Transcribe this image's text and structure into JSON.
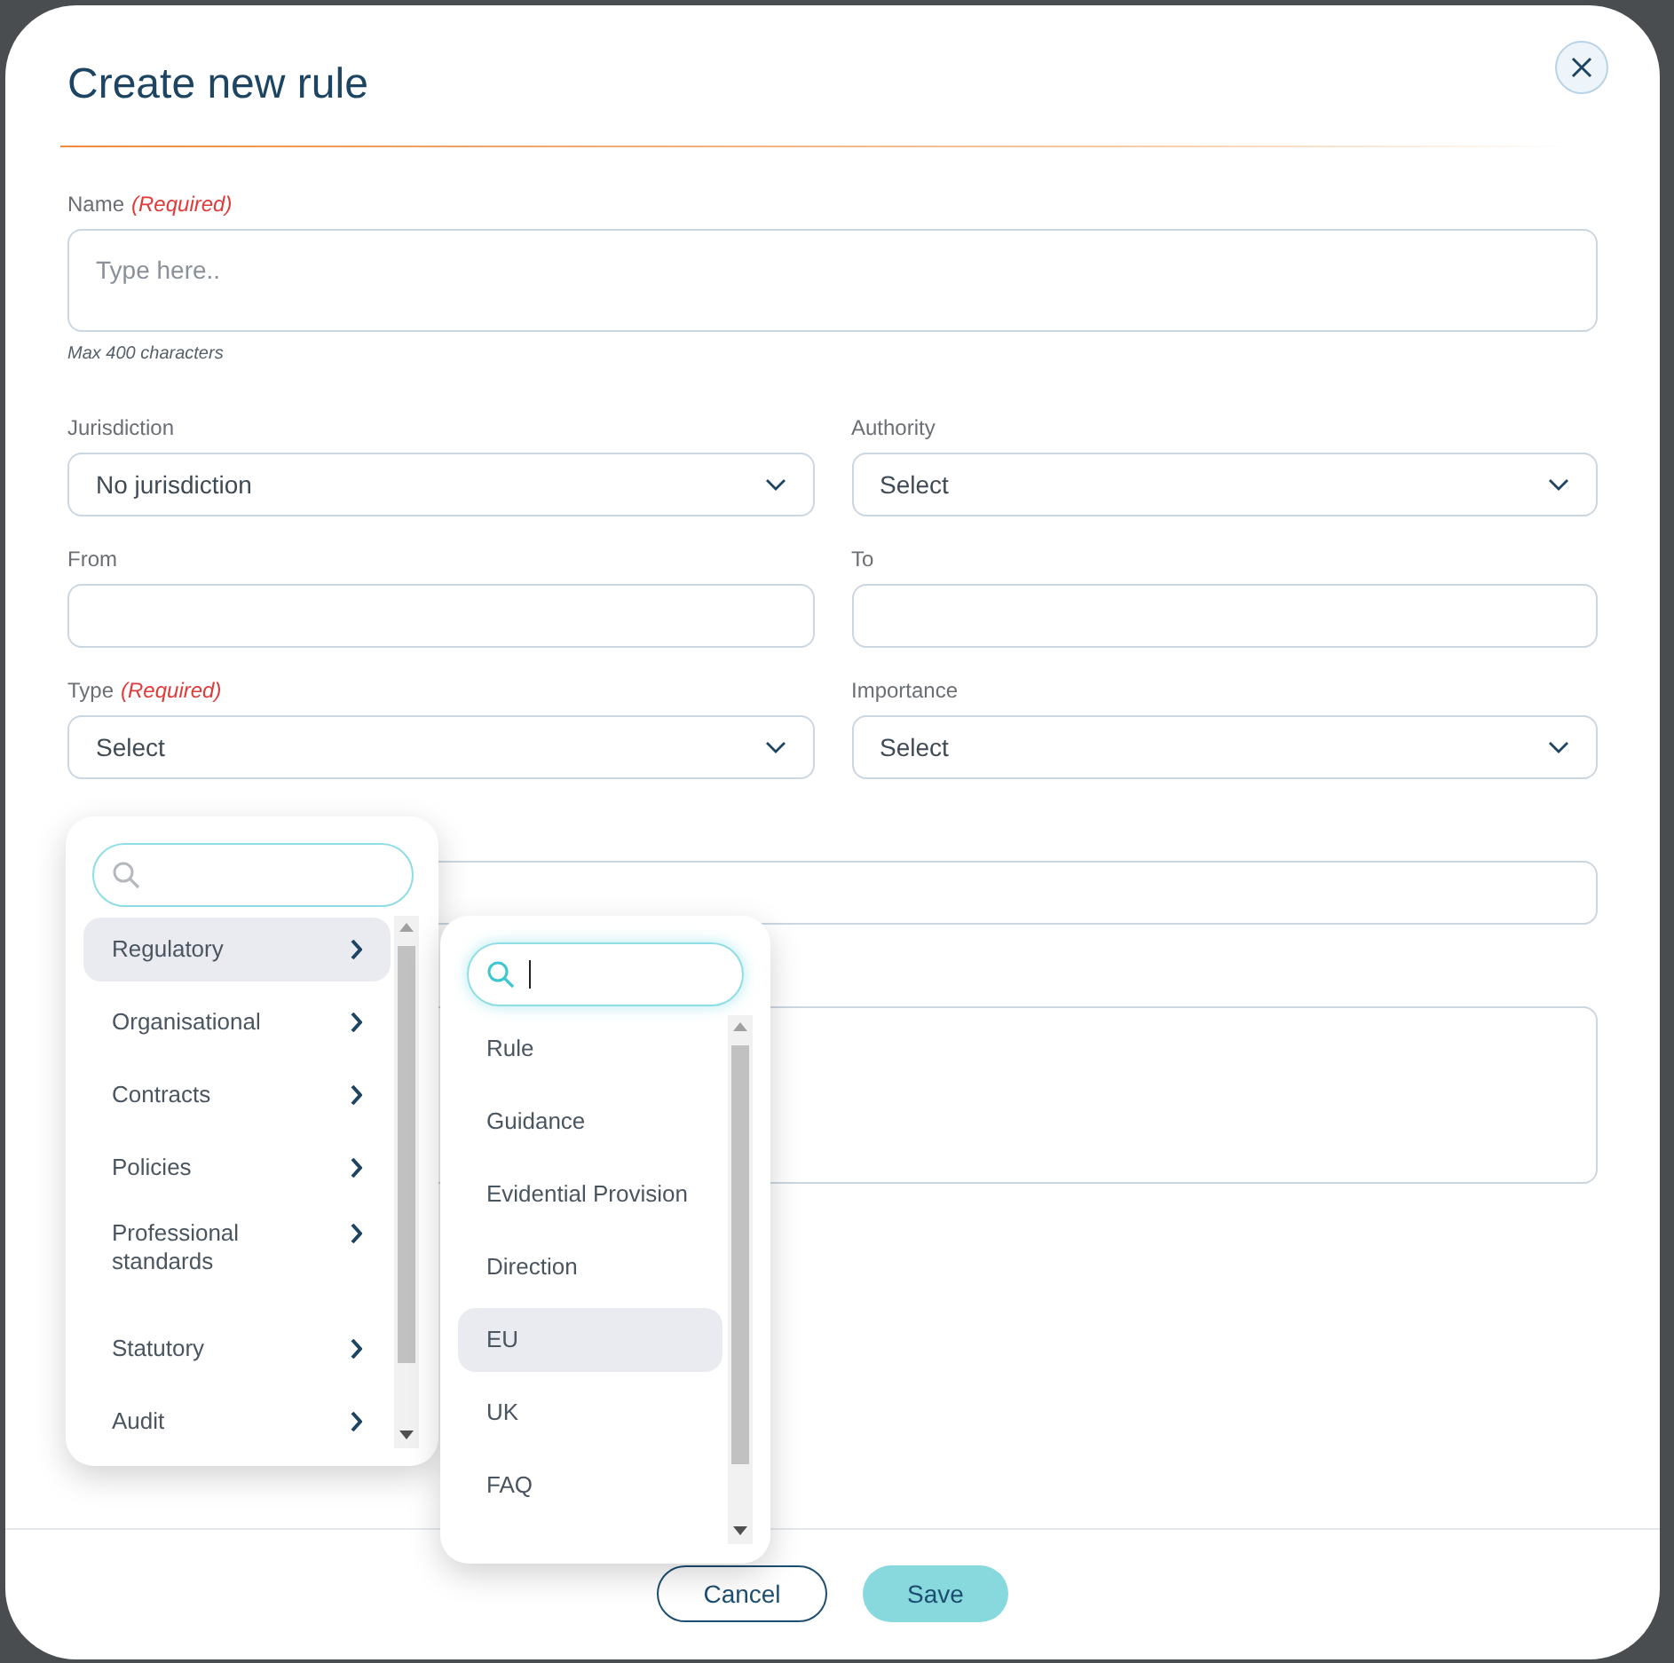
{
  "dialog": {
    "title": "Create new rule"
  },
  "name_field": {
    "label": "Name",
    "required": "(Required)",
    "placeholder": "Type here..",
    "hint": "Max 400 characters"
  },
  "fields": [
    {
      "kind": "select",
      "label": "Jurisdiction",
      "value": "No jurisdiction"
    },
    {
      "kind": "select",
      "label": "Authority",
      "value": "Select"
    },
    {
      "kind": "text",
      "label": "From"
    },
    {
      "kind": "text",
      "label": "To"
    },
    {
      "kind": "select",
      "label": "Type",
      "required": "(Required)",
      "value": "Select"
    },
    {
      "kind": "select",
      "label": "Importance",
      "value": "Select"
    }
  ],
  "covered_fields": [
    {
      "kind": "input"
    },
    {
      "kind": "textarea"
    }
  ],
  "type_menu": {
    "search_focused": false,
    "items": [
      {
        "label": "Regulatory",
        "selected": true
      },
      {
        "label": "Organisational",
        "selected": false
      },
      {
        "label": "Contracts",
        "selected": false
      },
      {
        "label": "Policies",
        "selected": false
      },
      {
        "label": "Professional standards",
        "selected": false
      },
      {
        "label": "Statutory",
        "selected": false
      },
      {
        "label": "Audit",
        "selected": false
      }
    ]
  },
  "sub_menu": {
    "search_focused": true,
    "items": [
      {
        "label": "Rule",
        "selected": false
      },
      {
        "label": "Guidance",
        "selected": false
      },
      {
        "label": "Evidential Provision",
        "selected": false
      },
      {
        "label": "Direction",
        "selected": false
      },
      {
        "label": "EU",
        "selected": true
      },
      {
        "label": "UK",
        "selected": false
      },
      {
        "label": "FAQ",
        "selected": false
      }
    ]
  },
  "buttons": [
    {
      "kind": "outline",
      "label": "Cancel"
    },
    {
      "kind": "primary",
      "label": "Save"
    }
  ]
}
